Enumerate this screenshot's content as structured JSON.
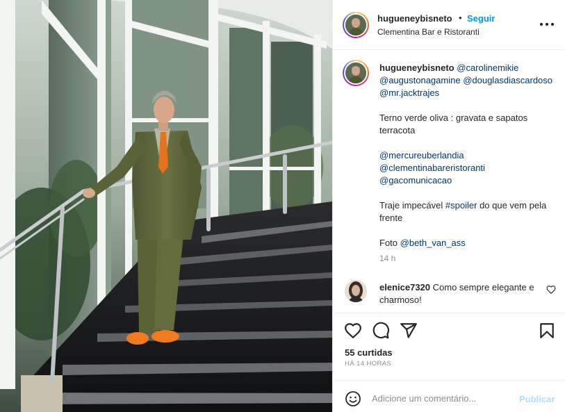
{
  "post": {
    "username": "hugueneybisneto",
    "follow_label": "Seguir",
    "separator": "•",
    "location": "Clementina Bar e Ristoranti",
    "more_icon": "more-horizontal-icon"
  },
  "caption": {
    "username": "hugueneybisneto",
    "mentions_line": [
      "@carolinemikie",
      "@augustonagamine",
      "@douglasdiascardoso",
      "@mr.jacktrajes"
    ],
    "paragraph1": "Terno verde oliva : gravata e sapatos terracota",
    "paragraph2_mentions": [
      "@mercureuberlandia",
      "@clementinabareristoranti",
      "@gacomunicacao"
    ],
    "paragraph3_before": "Traje impecável",
    "paragraph3_hashtag": "#spoiler",
    "paragraph3_after": "do que vem pela frente",
    "photo_credit_label": "Foto",
    "photo_credit_mention": "@beth_van_ass",
    "time": "14 h"
  },
  "comments": [
    {
      "username": "elenice7320",
      "text": "Como sempre elegante e charmoso!"
    }
  ],
  "actions": {
    "like_icon": "heart-icon",
    "comment_icon": "comment-icon",
    "share_icon": "share-icon",
    "save_icon": "bookmark-icon",
    "likes": "55 curtidas",
    "ago": "HÁ 14 HORAS"
  },
  "add_comment": {
    "placeholder": "Adicione um comentário...",
    "publish_label": "Publicar",
    "emoji_icon": "emoji-icon"
  },
  "colors": {
    "link_blue": "#0095f6",
    "mention_blue": "#00376b",
    "muted": "#8e8e8e",
    "publish_disabled": "#b2dffc"
  }
}
